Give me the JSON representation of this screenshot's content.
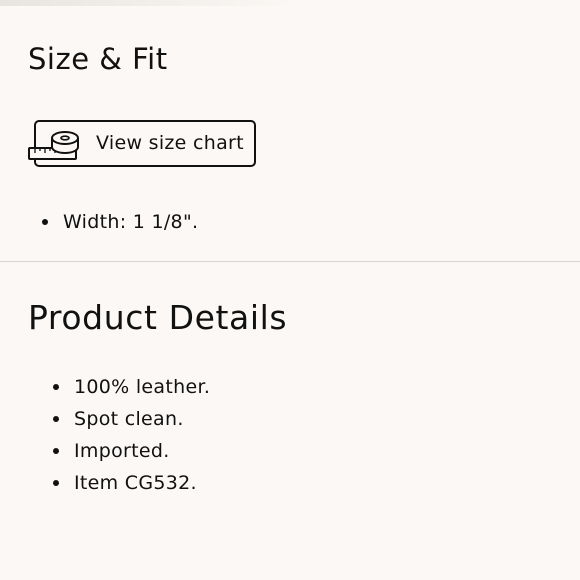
{
  "size_fit": {
    "title": "Size & Fit",
    "size_chart_button": {
      "label": "View size chart",
      "icon": "measuring-tape-icon"
    },
    "specs": [
      "Width: 1 1/8\"."
    ]
  },
  "product_details": {
    "title": "Product Details",
    "items": [
      "100% leather.",
      "Spot clean.",
      "Imported.",
      "Item CG532."
    ]
  },
  "colors": {
    "background": "#fbf8f5",
    "text": "#111111",
    "divider": "#d9d4cf"
  }
}
